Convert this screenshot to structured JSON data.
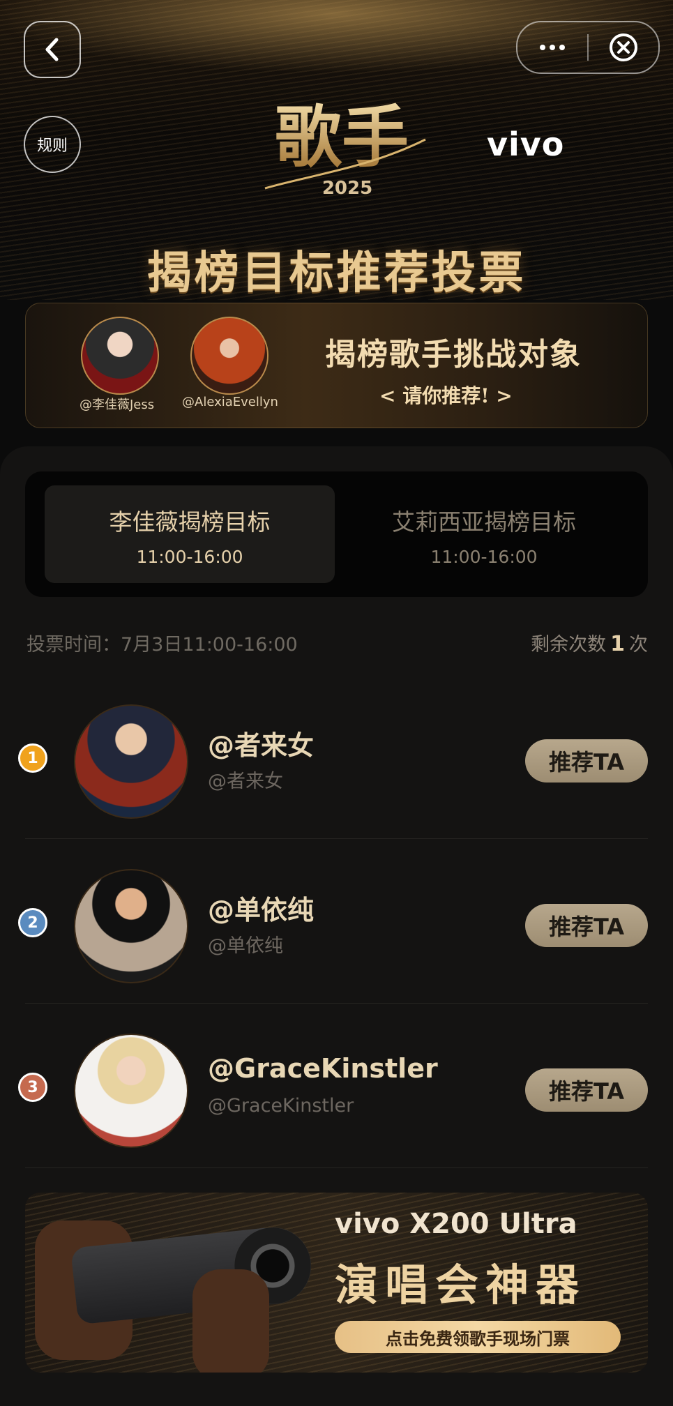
{
  "header": {
    "back_icon": "chevron-left-icon",
    "more_icon": "more-dots-icon",
    "close_icon": "close-circle-icon",
    "rules_label": "规则",
    "logo_text": "歌手",
    "logo_year": "2025",
    "brand": "vivo",
    "title": "揭榜目标推荐投票"
  },
  "challenge": {
    "singers": [
      {
        "handle": "@李佳薇Jess"
      },
      {
        "handle": "@AlexiaEvellyn"
      }
    ],
    "title": "揭榜歌手挑战对象",
    "subtitle": "< 请你推荐! >"
  },
  "tabs": [
    {
      "title": "李佳薇揭榜目标",
      "time": "11:00-16:00",
      "active": true
    },
    {
      "title": "艾莉西亚揭榜目标",
      "time": "11:00-16:00",
      "active": false
    }
  ],
  "vote": {
    "time_label": "投票时间：7月3日11:00-16:00",
    "remaining_prefix": "剩余次数",
    "remaining_count": "1",
    "remaining_suffix": "次"
  },
  "candidates": [
    {
      "rank": "1",
      "name": "@者来女",
      "handle": "@者来女",
      "button": "推荐TA"
    },
    {
      "rank": "2",
      "name": "@单依纯",
      "handle": "@单依纯",
      "button": "推荐TA"
    },
    {
      "rank": "3",
      "name": "@GraceKinstler",
      "handle": "@GraceKinstler",
      "button": "推荐TA"
    }
  ],
  "ad": {
    "brand": "vivo X200 Ultra",
    "slogan": "演唱会神器",
    "cta": "点击免费领歌手现场门票"
  },
  "colors": {
    "background": "#0b0b0b",
    "gold": "#e8c991",
    "button": "#b7a78c",
    "rank1": "#f0a21d",
    "rank2": "#5a8bbf",
    "rank3": "#c56a4f"
  }
}
